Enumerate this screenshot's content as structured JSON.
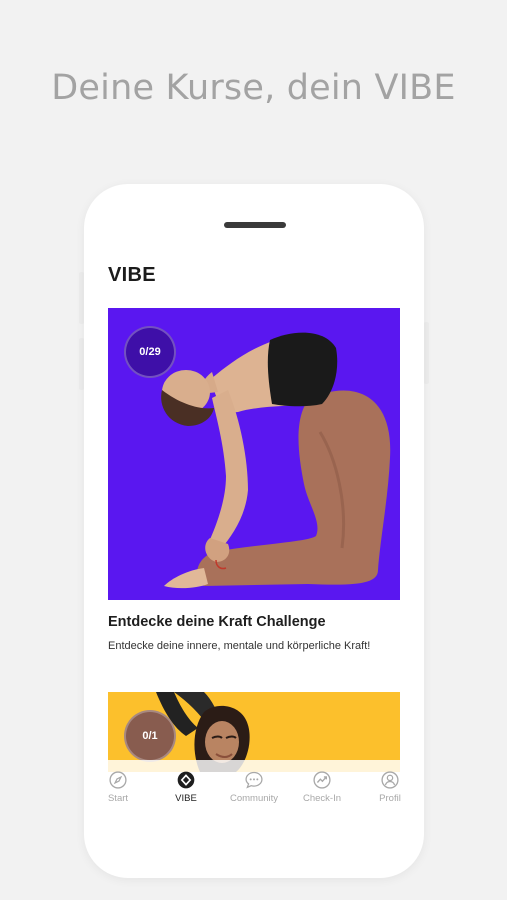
{
  "headline": "Deine Kurse, dein VIBE",
  "app": {
    "title": "VIBE"
  },
  "courses": [
    {
      "progress": "0/29",
      "title": "Entdecke deine Kraft Challenge",
      "description": "Entdecke deine innere, mentale und körperliche Kraft!",
      "color": "#5a17f0"
    },
    {
      "progress": "0/1",
      "color": "#fcc02c"
    }
  ],
  "tabs": [
    {
      "label": "Start",
      "icon": "compass-icon",
      "active": false
    },
    {
      "label": "VIBE",
      "icon": "vibe-logo-icon",
      "active": true
    },
    {
      "label": "Community",
      "icon": "chat-bubble-icon",
      "active": false
    },
    {
      "label": "Check-In",
      "icon": "trend-chart-icon",
      "active": false
    },
    {
      "label": "Profil",
      "icon": "user-icon",
      "active": false
    }
  ],
  "colors": {
    "background": "#f2f2f2",
    "card_purple": "#5a17f0",
    "card_yellow": "#fcc02c"
  }
}
